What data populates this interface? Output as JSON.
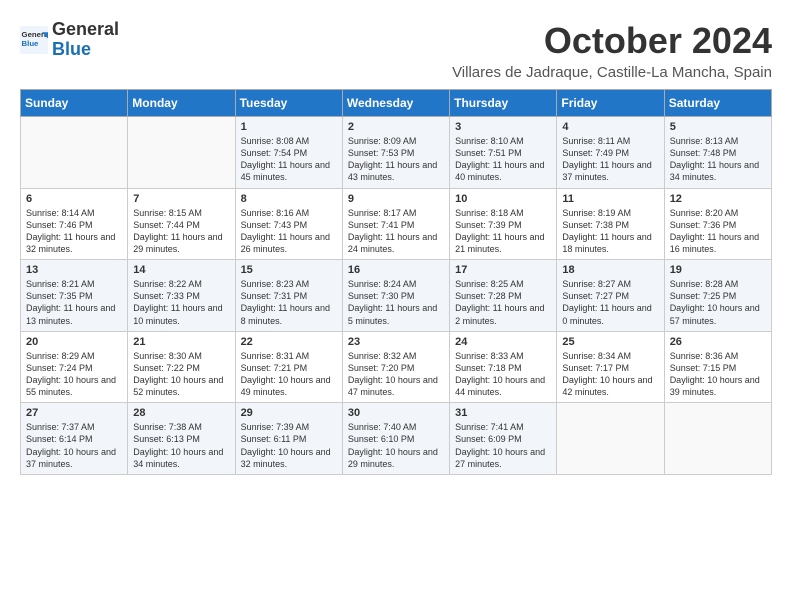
{
  "logo": {
    "line1": "General",
    "line2": "Blue"
  },
  "title": "October 2024",
  "location": "Villares de Jadraque, Castille-La Mancha, Spain",
  "days_of_week": [
    "Sunday",
    "Monday",
    "Tuesday",
    "Wednesday",
    "Thursday",
    "Friday",
    "Saturday"
  ],
  "weeks": [
    [
      {
        "day": "",
        "content": ""
      },
      {
        "day": "",
        "content": ""
      },
      {
        "day": "1",
        "content": "Sunrise: 8:08 AM\nSunset: 7:54 PM\nDaylight: 11 hours and 45 minutes."
      },
      {
        "day": "2",
        "content": "Sunrise: 8:09 AM\nSunset: 7:53 PM\nDaylight: 11 hours and 43 minutes."
      },
      {
        "day": "3",
        "content": "Sunrise: 8:10 AM\nSunset: 7:51 PM\nDaylight: 11 hours and 40 minutes."
      },
      {
        "day": "4",
        "content": "Sunrise: 8:11 AM\nSunset: 7:49 PM\nDaylight: 11 hours and 37 minutes."
      },
      {
        "day": "5",
        "content": "Sunrise: 8:13 AM\nSunset: 7:48 PM\nDaylight: 11 hours and 34 minutes."
      }
    ],
    [
      {
        "day": "6",
        "content": "Sunrise: 8:14 AM\nSunset: 7:46 PM\nDaylight: 11 hours and 32 minutes."
      },
      {
        "day": "7",
        "content": "Sunrise: 8:15 AM\nSunset: 7:44 PM\nDaylight: 11 hours and 29 minutes."
      },
      {
        "day": "8",
        "content": "Sunrise: 8:16 AM\nSunset: 7:43 PM\nDaylight: 11 hours and 26 minutes."
      },
      {
        "day": "9",
        "content": "Sunrise: 8:17 AM\nSunset: 7:41 PM\nDaylight: 11 hours and 24 minutes."
      },
      {
        "day": "10",
        "content": "Sunrise: 8:18 AM\nSunset: 7:39 PM\nDaylight: 11 hours and 21 minutes."
      },
      {
        "day": "11",
        "content": "Sunrise: 8:19 AM\nSunset: 7:38 PM\nDaylight: 11 hours and 18 minutes."
      },
      {
        "day": "12",
        "content": "Sunrise: 8:20 AM\nSunset: 7:36 PM\nDaylight: 11 hours and 16 minutes."
      }
    ],
    [
      {
        "day": "13",
        "content": "Sunrise: 8:21 AM\nSunset: 7:35 PM\nDaylight: 11 hours and 13 minutes."
      },
      {
        "day": "14",
        "content": "Sunrise: 8:22 AM\nSunset: 7:33 PM\nDaylight: 11 hours and 10 minutes."
      },
      {
        "day": "15",
        "content": "Sunrise: 8:23 AM\nSunset: 7:31 PM\nDaylight: 11 hours and 8 minutes."
      },
      {
        "day": "16",
        "content": "Sunrise: 8:24 AM\nSunset: 7:30 PM\nDaylight: 11 hours and 5 minutes."
      },
      {
        "day": "17",
        "content": "Sunrise: 8:25 AM\nSunset: 7:28 PM\nDaylight: 11 hours and 2 minutes."
      },
      {
        "day": "18",
        "content": "Sunrise: 8:27 AM\nSunset: 7:27 PM\nDaylight: 11 hours and 0 minutes."
      },
      {
        "day": "19",
        "content": "Sunrise: 8:28 AM\nSunset: 7:25 PM\nDaylight: 10 hours and 57 minutes."
      }
    ],
    [
      {
        "day": "20",
        "content": "Sunrise: 8:29 AM\nSunset: 7:24 PM\nDaylight: 10 hours and 55 minutes."
      },
      {
        "day": "21",
        "content": "Sunrise: 8:30 AM\nSunset: 7:22 PM\nDaylight: 10 hours and 52 minutes."
      },
      {
        "day": "22",
        "content": "Sunrise: 8:31 AM\nSunset: 7:21 PM\nDaylight: 10 hours and 49 minutes."
      },
      {
        "day": "23",
        "content": "Sunrise: 8:32 AM\nSunset: 7:20 PM\nDaylight: 10 hours and 47 minutes."
      },
      {
        "day": "24",
        "content": "Sunrise: 8:33 AM\nSunset: 7:18 PM\nDaylight: 10 hours and 44 minutes."
      },
      {
        "day": "25",
        "content": "Sunrise: 8:34 AM\nSunset: 7:17 PM\nDaylight: 10 hours and 42 minutes."
      },
      {
        "day": "26",
        "content": "Sunrise: 8:36 AM\nSunset: 7:15 PM\nDaylight: 10 hours and 39 minutes."
      }
    ],
    [
      {
        "day": "27",
        "content": "Sunrise: 7:37 AM\nSunset: 6:14 PM\nDaylight: 10 hours and 37 minutes."
      },
      {
        "day": "28",
        "content": "Sunrise: 7:38 AM\nSunset: 6:13 PM\nDaylight: 10 hours and 34 minutes."
      },
      {
        "day": "29",
        "content": "Sunrise: 7:39 AM\nSunset: 6:11 PM\nDaylight: 10 hours and 32 minutes."
      },
      {
        "day": "30",
        "content": "Sunrise: 7:40 AM\nSunset: 6:10 PM\nDaylight: 10 hours and 29 minutes."
      },
      {
        "day": "31",
        "content": "Sunrise: 7:41 AM\nSunset: 6:09 PM\nDaylight: 10 hours and 27 minutes."
      },
      {
        "day": "",
        "content": ""
      },
      {
        "day": "",
        "content": ""
      }
    ]
  ]
}
